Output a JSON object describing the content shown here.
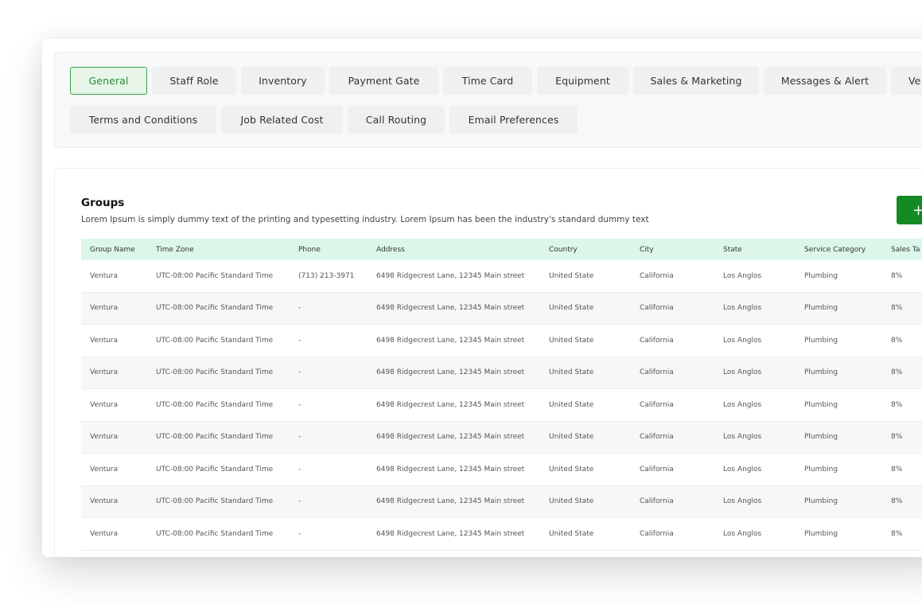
{
  "tabs": {
    "row1": [
      {
        "label": "General",
        "active": true
      },
      {
        "label": "Staff Role"
      },
      {
        "label": "Inventory"
      },
      {
        "label": "Payment Gate"
      },
      {
        "label": "Time Card"
      },
      {
        "label": "Equipment"
      },
      {
        "label": "Sales & Marketing"
      },
      {
        "label": "Messages & Alert"
      },
      {
        "label": "Ve"
      }
    ],
    "row2": [
      {
        "label": "Terms and Conditions"
      },
      {
        "label": "Job Related Cost"
      },
      {
        "label": "Call Routing"
      },
      {
        "label": "Email Preferences"
      }
    ]
  },
  "groups": {
    "title": "Groups",
    "description": "Lorem Ipsum is simply dummy text of the printing and typesetting industry. Lorem Ipsum has been the industry's standard dummy text",
    "add_button_icon": "+",
    "columns": [
      "Group Name",
      "Time Zone",
      "Phone",
      "Address",
      "Country",
      "City",
      "State",
      "Service Category",
      "Sales Ta"
    ],
    "rows": [
      [
        "Ventura",
        "UTC-08:00 Pacific Standard Time",
        "(713) 213-3971",
        "6498 Ridgecrest Lane, 12345 Main street",
        "United State",
        "California",
        "Los Anglos",
        "Plumbing",
        "8%"
      ],
      [
        "Ventura",
        "UTC-08:00 Pacific Standard Time",
        "-",
        "6498 Ridgecrest Lane, 12345 Main street",
        "United State",
        "California",
        "Los Anglos",
        "Plumbing",
        "8%"
      ],
      [
        "Ventura",
        "UTC-08:00 Pacific Standard Time",
        "-",
        "6498 Ridgecrest Lane, 12345 Main street",
        "United State",
        "California",
        "Los Anglos",
        "Plumbing",
        "8%"
      ],
      [
        "Ventura",
        "UTC-08:00 Pacific Standard Time",
        "-",
        "6498 Ridgecrest Lane, 12345 Main street",
        "United State",
        "California",
        "Los Anglos",
        "Plumbing",
        "8%"
      ],
      [
        "Ventura",
        "UTC-08:00 Pacific Standard Time",
        "-",
        "6498 Ridgecrest Lane, 12345 Main street",
        "United State",
        "California",
        "Los Anglos",
        "Plumbing",
        "8%"
      ],
      [
        "Ventura",
        "UTC-08:00 Pacific Standard Time",
        "-",
        "6498 Ridgecrest Lane, 12345 Main street",
        "United State",
        "California",
        "Los Anglos",
        "Plumbing",
        "8%"
      ],
      [
        "Ventura",
        "UTC-08:00 Pacific Standard Time",
        "-",
        "6498 Ridgecrest Lane, 12345 Main street",
        "United State",
        "California",
        "Los Anglos",
        "Plumbing",
        "8%"
      ],
      [
        "Ventura",
        "UTC-08:00 Pacific Standard Time",
        "-",
        "6498 Ridgecrest Lane, 12345 Main street",
        "United State",
        "California",
        "Los Anglos",
        "Plumbing",
        "8%"
      ],
      [
        "Ventura",
        "UTC-08:00 Pacific Standard Time",
        "-",
        "6498 Ridgecrest Lane, 12345 Main street",
        "United State",
        "California",
        "Los Anglos",
        "Plumbing",
        "8%"
      ]
    ]
  },
  "colors": {
    "accent": "#138a24",
    "active_tab_bg": "#e6f5e8",
    "table_header_bg": "#dcf7ea"
  }
}
